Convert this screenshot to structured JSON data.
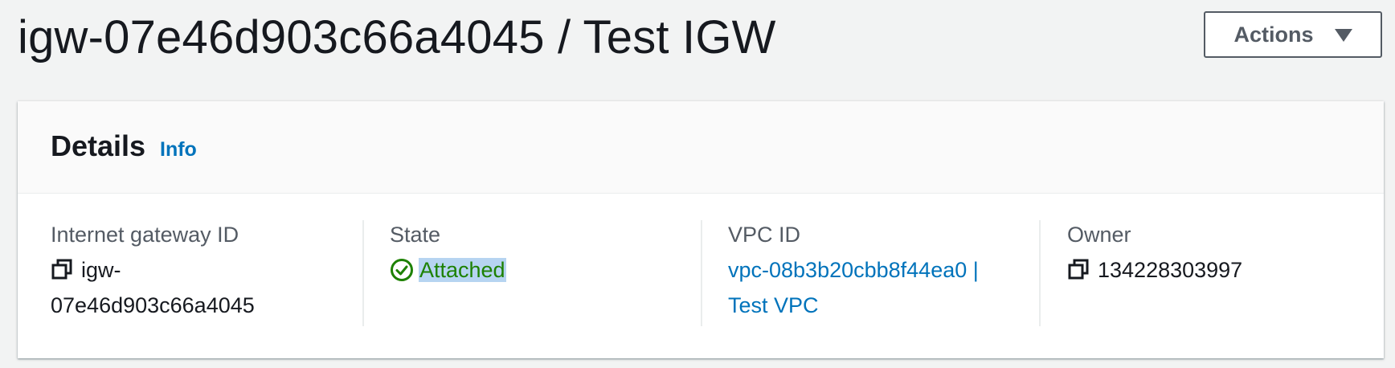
{
  "header": {
    "title": "igw-07e46d903c66a4045 / Test IGW",
    "actions_label": "Actions"
  },
  "details": {
    "heading": "Details",
    "info_link": "Info",
    "internet_gateway": {
      "label": "Internet gateway ID",
      "value_line1": "igw-",
      "value_line2": "07e46d903c66a4045"
    },
    "state": {
      "label": "State",
      "value": "Attached",
      "status_color": "#1d8102"
    },
    "vpc": {
      "label": "VPC ID",
      "value_line1": "vpc-08b3b20cbb8f44ea0 |",
      "value_line2": "Test VPC"
    },
    "owner": {
      "label": "Owner",
      "value": "134228303997"
    }
  },
  "colors": {
    "background": "#f2f3f3",
    "link": "#0073bb",
    "success": "#1d8102",
    "selection": "#b6d4f1"
  }
}
